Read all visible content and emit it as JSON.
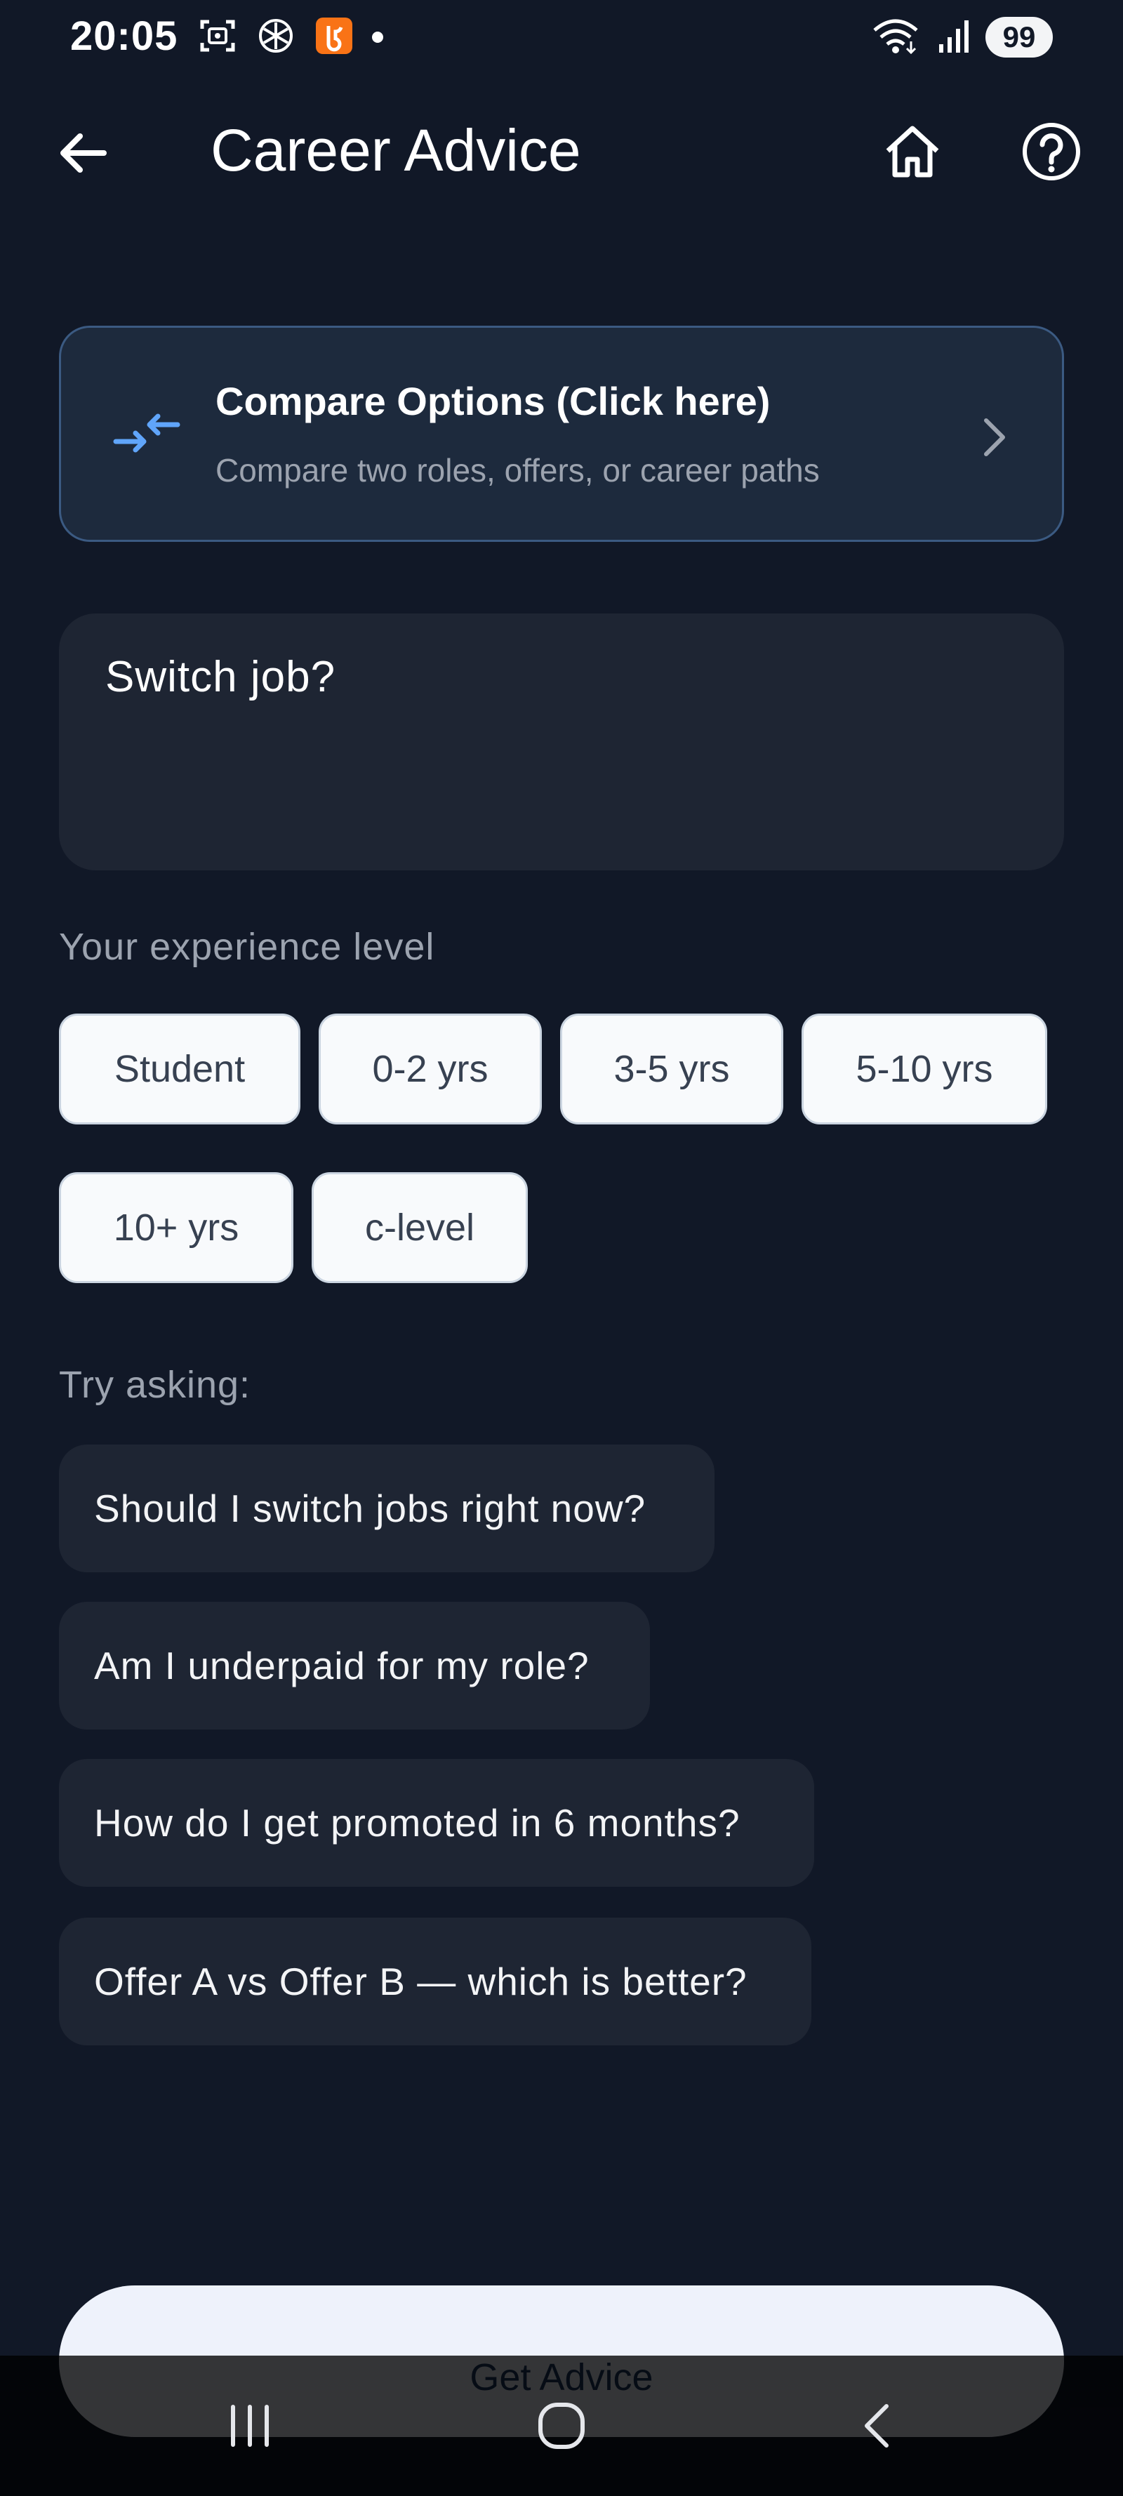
{
  "status_bar": {
    "time": "20:05",
    "battery": "99",
    "left_icons": [
      "screenshot-icon",
      "openai-icon",
      "app-notification-icon",
      "dot-icon"
    ],
    "right_icons": [
      "wifi-icon",
      "signal-icon",
      "battery-icon"
    ]
  },
  "header": {
    "title": "Career Advice",
    "icons": [
      "back-arrow-icon",
      "home-icon",
      "help-icon"
    ]
  },
  "compare": {
    "title": "Compare Options (Click here)",
    "subtitle": "Compare two roles, offers, or career paths",
    "icon": "compare-arrows-icon",
    "accent": "#60a5fa"
  },
  "question": {
    "value": "Switch job?"
  },
  "experience": {
    "label": "Your experience level",
    "options": [
      "Student",
      "0-2 yrs",
      "3-5 yrs",
      "5-10 yrs",
      "10+ yrs",
      "c-level"
    ]
  },
  "suggestions": {
    "label": "Try asking:",
    "items": [
      "Should I switch jobs right now?",
      "Am I underpaid for my role?",
      "How do I get promoted in 6 months?",
      "Offer A vs Offer B — which is better?"
    ]
  },
  "action": {
    "label": "Get Advice"
  },
  "nav": {
    "icons": [
      "recent-apps-icon",
      "home-nav-icon",
      "back-nav-icon"
    ]
  },
  "colors": {
    "background": "#111827",
    "card": "#1e2533",
    "chip": "#f8fafc"
  }
}
